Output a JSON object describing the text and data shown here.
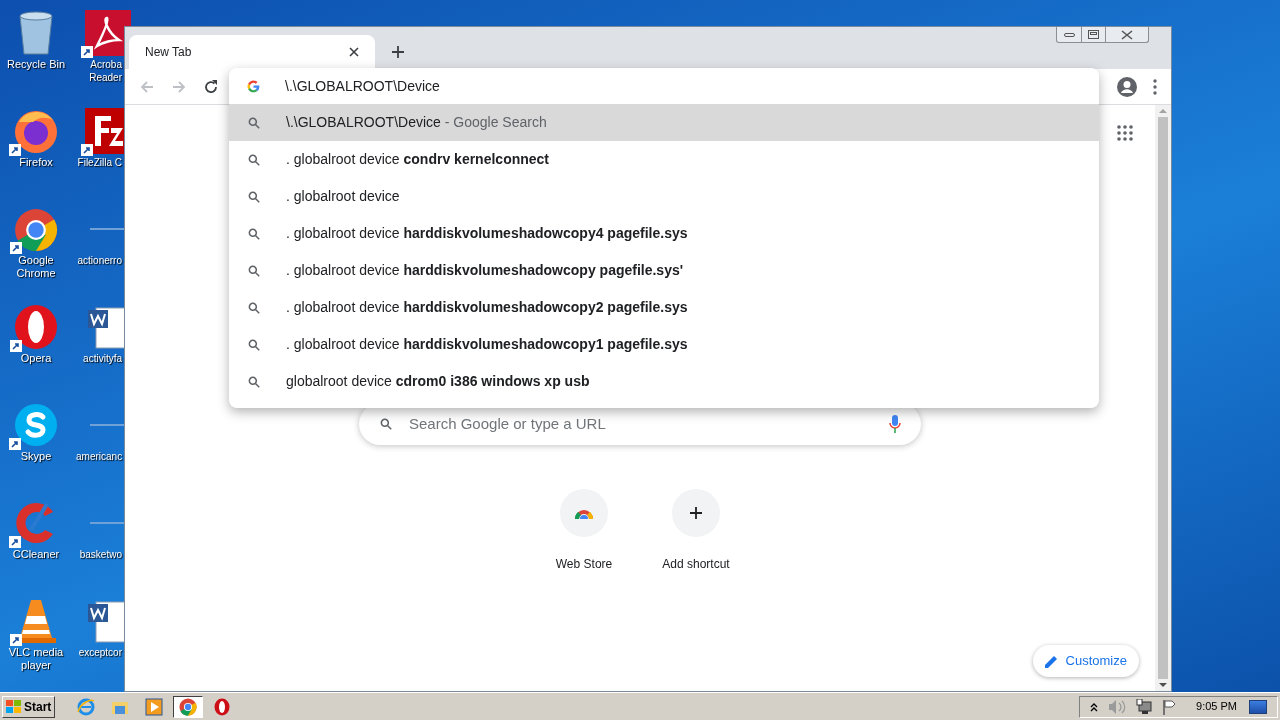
{
  "desktop_icons": [
    {
      "label": "Recycle Bin",
      "kind": "recycle",
      "shortcut": false
    },
    {
      "label": "Acroba Reader",
      "kind": "acrobat",
      "shortcut": true
    },
    {
      "label": "Firefox",
      "kind": "firefox",
      "shortcut": true
    },
    {
      "label": "FileZilla C",
      "kind": "filezilla",
      "shortcut": true
    },
    {
      "label": "Google Chrome",
      "kind": "chrome",
      "shortcut": true
    },
    {
      "label": "actionerro",
      "kind": "file",
      "shortcut": false
    },
    {
      "label": "Opera",
      "kind": "opera",
      "shortcut": true
    },
    {
      "label": "activityfa",
      "kind": "word",
      "shortcut": false
    },
    {
      "label": "Skype",
      "kind": "skype",
      "shortcut": true
    },
    {
      "label": "americanc",
      "kind": "file",
      "shortcut": false
    },
    {
      "label": "CCleaner",
      "kind": "ccleaner",
      "shortcut": true
    },
    {
      "label": "basketwo",
      "kind": "file",
      "shortcut": false
    },
    {
      "label": "VLC media player",
      "kind": "vlc",
      "shortcut": true
    },
    {
      "label": "exceptcor",
      "kind": "word",
      "shortcut": false
    }
  ],
  "browser": {
    "tabs": [
      {
        "label": "New Tab",
        "selected": true
      }
    ],
    "nav": {
      "back_disabled": true,
      "forward_disabled": true
    },
    "omnibox": {
      "value": "\\.\\GLOBALROOT\\Device"
    },
    "suggestions": [
      {
        "text": "\\.\\GLOBALROOT\\Device",
        "suffix": " - Google Search",
        "selected": true
      },
      {
        "text": ". globalroot device **condrv kernelconnect**",
        "selected": false
      },
      {
        "text": ". globalroot device",
        "selected": false
      },
      {
        "text": ". globalroot device **harddiskvolumeshadowcopy4 pagefile.sys**",
        "selected": false
      },
      {
        "text": ". globalroot device **harddiskvolumeshadowcopy pagefile.sys'**",
        "selected": false
      },
      {
        "text": ". globalroot device **harddiskvolumeshadowcopy2 pagefile.sys**",
        "selected": false
      },
      {
        "text": ". globalroot device **harddiskvolumeshadowcopy1 pagefile.sys**",
        "selected": false
      },
      {
        "text": "globalroot device **cdrom0 i386 windows xp usb**",
        "selected": false
      }
    ],
    "search": {
      "placeholder": "Search Google or type a URL"
    },
    "shortcuts": [
      {
        "label": "Web Store",
        "kind": "webstore"
      },
      {
        "label": "Add shortcut",
        "kind": "add"
      }
    ],
    "customize": "Customize"
  },
  "taskbar": {
    "start": "Start",
    "apps": [
      {
        "kind": "ie",
        "selected": false
      },
      {
        "kind": "explorer",
        "selected": false
      },
      {
        "kind": "media",
        "selected": false
      },
      {
        "kind": "chrome",
        "selected": true
      },
      {
        "kind": "opera",
        "selected": false
      }
    ],
    "clock": "9:05 PM"
  }
}
